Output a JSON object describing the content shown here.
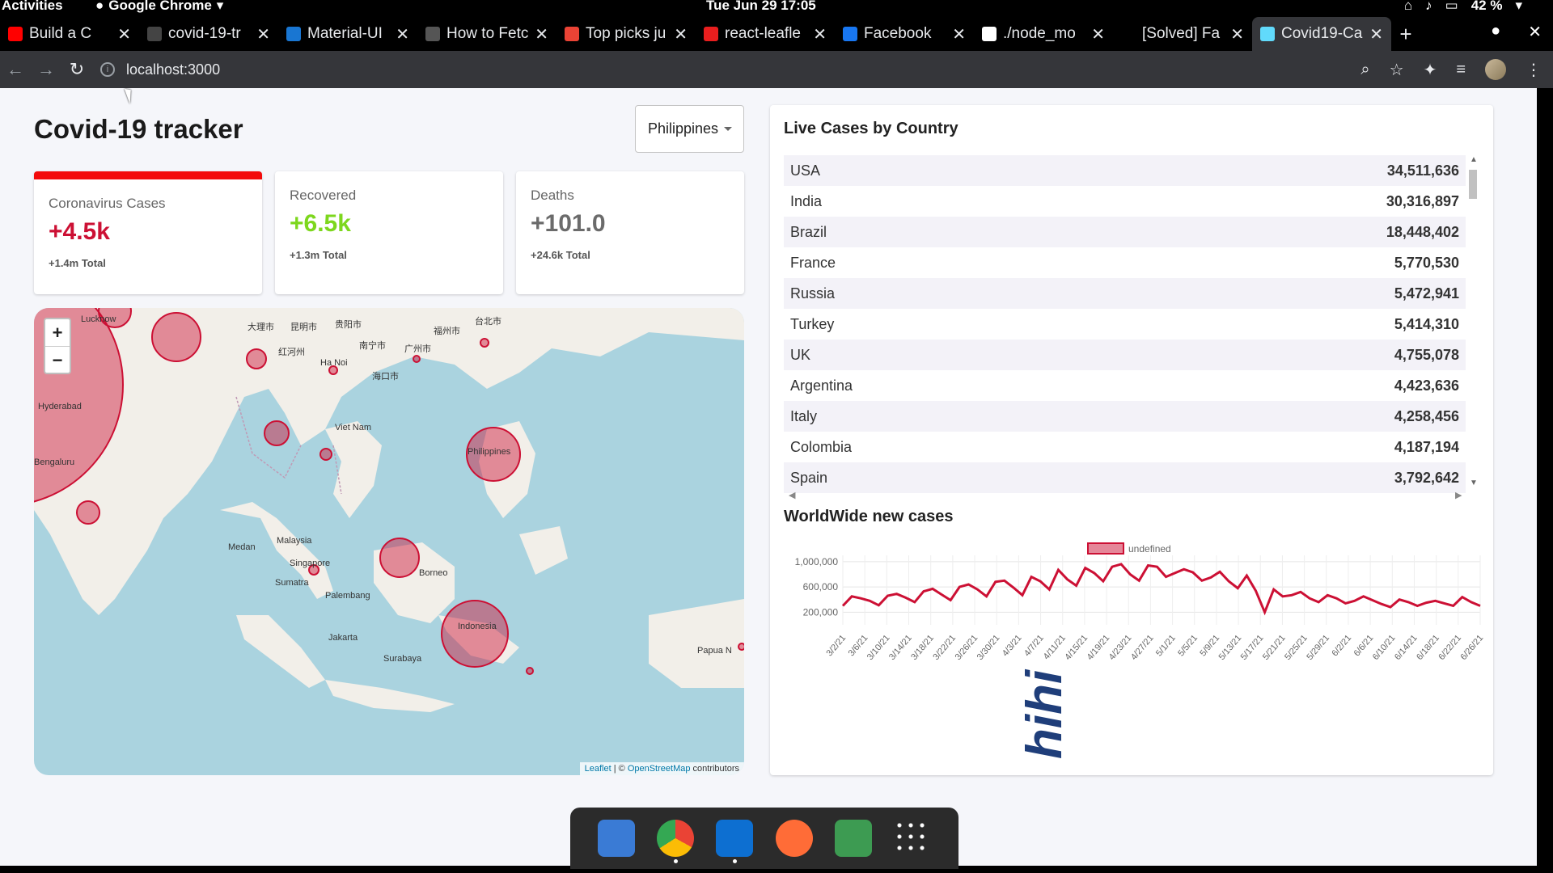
{
  "system_bar": {
    "activities": "Activities",
    "app_name": "Google Chrome",
    "clock": "Tue Jun 29  17:05",
    "battery": "42 %"
  },
  "tabs": [
    {
      "title": "Build a C",
      "favicon_color": "#ff0000"
    },
    {
      "title": "covid-19-tr",
      "favicon_color": "#444444"
    },
    {
      "title": "Material-UI",
      "favicon_color": "#1976d2"
    },
    {
      "title": "How to Fetc",
      "favicon_color": "#555555"
    },
    {
      "title": "Top picks ju",
      "favicon_color": "#ea4335"
    },
    {
      "title": "react-leafle",
      "favicon_color": "#e91e1e"
    },
    {
      "title": "Facebook",
      "favicon_color": "#1877f2"
    },
    {
      "title": "./node_mo",
      "favicon_color": "#ffffff"
    },
    {
      "title": "[Solved] Fa",
      "favicon_color": "#000000"
    },
    {
      "title": "Covid19-Ca",
      "favicon_color": "#61dafb",
      "active": true
    }
  ],
  "omnibox": {
    "url": "localhost:3000"
  },
  "app": {
    "title": "Covid-19 tracker",
    "selected_country": "Philippines"
  },
  "infoboxes": [
    {
      "label": "Coronavirus Cases",
      "cases": "+4.5k",
      "total": "+1.4m Total",
      "color": "#cc1034"
    },
    {
      "label": "Recovered",
      "cases": "+6.5k",
      "total": "+1.3m Total",
      "color": "#7dd71d"
    },
    {
      "label": "Deaths",
      "cases": "+101.0",
      "total": "+24.6k Total",
      "color": "#6b6b6b"
    }
  ],
  "map": {
    "zoom_in": "+",
    "zoom_out": "−",
    "attribution": "Leaflet",
    "attribution_mid": " | © ",
    "attribution_osm": "OpenStreetMap",
    "attribution_tail": " contributors",
    "labels": [
      {
        "text": "Lucknow"
      },
      {
        "text": "大理市"
      },
      {
        "text": "昆明市"
      },
      {
        "text": "贵阳市"
      },
      {
        "text": "南宁市"
      },
      {
        "text": "广州市"
      },
      {
        "text": "红河州"
      },
      {
        "text": "Ha Noi"
      },
      {
        "text": "海口市"
      },
      {
        "text": "Hyderabad"
      },
      {
        "text": "Bengaluru"
      },
      {
        "text": "Viet Nam"
      },
      {
        "text": "Malaysia"
      },
      {
        "text": "Singapore"
      },
      {
        "text": "Medan"
      },
      {
        "text": "Palembang"
      },
      {
        "text": "Jakarta"
      },
      {
        "text": "Surabaya"
      },
      {
        "text": "Borneo"
      },
      {
        "text": "Indonesia"
      },
      {
        "text": "Philippines"
      },
      {
        "text": "Papua N"
      },
      {
        "text": "Sumatra"
      },
      {
        "text": "台北市"
      },
      {
        "text": "福州市"
      }
    ]
  },
  "live_cases": {
    "title": "Live Cases by Country",
    "rows": [
      {
        "country": "USA",
        "cases": "34,511,636"
      },
      {
        "country": "India",
        "cases": "30,316,897"
      },
      {
        "country": "Brazil",
        "cases": "18,448,402"
      },
      {
        "country": "France",
        "cases": "5,770,530"
      },
      {
        "country": "Russia",
        "cases": "5,472,941"
      },
      {
        "country": "Turkey",
        "cases": "5,414,310"
      },
      {
        "country": "UK",
        "cases": "4,755,078"
      },
      {
        "country": "Argentina",
        "cases": "4,423,636"
      },
      {
        "country": "Italy",
        "cases": "4,258,456"
      },
      {
        "country": "Colombia",
        "cases": "4,187,194"
      },
      {
        "country": "Spain",
        "cases": "3,792,642"
      }
    ]
  },
  "worldwide": {
    "title": "WorldWide new cases"
  },
  "chart_data": {
    "type": "line",
    "legend": "undefined",
    "color": "#cc1034",
    "yticks": [
      "1,000,000",
      "600,000",
      "200,000"
    ],
    "ylim": [
      0,
      1100000
    ],
    "xtick_labels": [
      "3/2/21",
      "3/6/21",
      "3/10/21",
      "3/14/21",
      "3/18/21",
      "3/22/21",
      "3/26/21",
      "3/30/21",
      "4/3/21",
      "4/7/21",
      "4/11/21",
      "4/15/21",
      "4/19/21",
      "4/23/21",
      "4/27/21",
      "5/1/21",
      "5/5/21",
      "5/9/21",
      "5/13/21",
      "5/17/21",
      "5/21/21",
      "5/25/21",
      "5/29/21",
      "6/2/21",
      "6/6/21",
      "6/10/21",
      "6/14/21",
      "6/18/21",
      "6/22/21",
      "6/26/21"
    ],
    "values": [
      300000,
      450000,
      420000,
      380000,
      310000,
      460000,
      490000,
      430000,
      360000,
      530000,
      570000,
      480000,
      390000,
      600000,
      640000,
      560000,
      450000,
      680000,
      700000,
      590000,
      470000,
      760000,
      690000,
      560000,
      870000,
      720000,
      620000,
      900000,
      820000,
      690000,
      920000,
      960000,
      800000,
      700000,
      940000,
      920000,
      760000,
      820000,
      880000,
      830000,
      700000,
      750000,
      840000,
      690000,
      580000,
      780000,
      540000,
      200000,
      560000,
      450000,
      470000,
      520000,
      420000,
      360000,
      470000,
      420000,
      340000,
      380000,
      450000,
      390000,
      330000,
      280000,
      400000,
      360000,
      300000,
      350000,
      380000,
      340000,
      300000,
      440000,
      360000,
      300000
    ]
  },
  "watermark": "hihi",
  "dock": [
    {
      "name": "files"
    },
    {
      "name": "chrome"
    },
    {
      "name": "vscode"
    },
    {
      "name": "postman"
    },
    {
      "name": "trash"
    },
    {
      "name": "app-grid"
    }
  ]
}
